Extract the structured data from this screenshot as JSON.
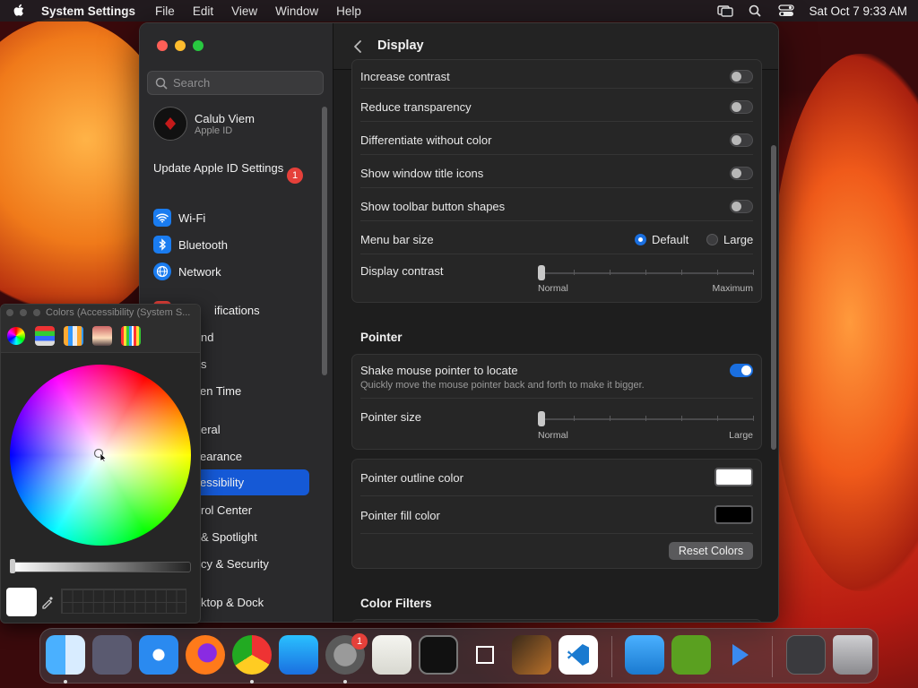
{
  "menubar": {
    "app_name": "System Settings",
    "items": [
      "File",
      "Edit",
      "View",
      "Window",
      "Help"
    ],
    "clock": "Sat Oct 7  9:33 AM"
  },
  "sidebar": {
    "search_placeholder": "Search",
    "profile_name": "Calub Viem",
    "profile_sub": "Apple ID",
    "update_label": "Update Apple ID Settings",
    "update_badge": "1",
    "items": [
      {
        "label": "Wi-Fi",
        "color": "#1a7cf0"
      },
      {
        "label": "Bluetooth",
        "color": "#1a7cf0"
      },
      {
        "label": "Network",
        "color": "#1a7cf0"
      },
      {
        "label": "Notifications",
        "color": "#e5403a"
      },
      {
        "label": "Sound",
        "color": "#e5403a"
      },
      {
        "label": "Focus",
        "color": "#5a4fd6"
      },
      {
        "label": "Screen Time",
        "color": "#5a4fd6"
      },
      {
        "label": "General",
        "color": "#8e8e93"
      },
      {
        "label": "Appearance",
        "color": "#1c1c1e"
      },
      {
        "label": "Accessibility",
        "color": "#1a7cf0"
      },
      {
        "label": "Control Center",
        "color": "#8e8e93"
      },
      {
        "label": "Siri & Spotlight",
        "color": "#b84ad6"
      },
      {
        "label": "Privacy & Security",
        "color": "#1a7cf0"
      },
      {
        "label": "Desktop & Dock",
        "color": "#1c1c1e"
      }
    ],
    "visible_labels": [
      "ifications",
      "nd",
      "s",
      "en Time",
      "eral",
      "earance",
      "essibility",
      "rol Center",
      "& Spotlight",
      "cy & Security",
      "ktop & Dock"
    ]
  },
  "content": {
    "title": "Display",
    "display_group": {
      "increase_contrast": "Increase contrast",
      "reduce_transparency": "Reduce transparency",
      "differentiate": "Differentiate without color",
      "window_title_icons": "Show window title icons",
      "toolbar_shapes": "Show toolbar button shapes",
      "menu_bar_size": "Menu bar size",
      "menu_bar_default": "Default",
      "menu_bar_large": "Large",
      "display_contrast": "Display contrast",
      "contrast_min": "Normal",
      "contrast_max": "Maximum",
      "contrast_value": 0
    },
    "pointer_title": "Pointer",
    "pointer_group": {
      "shake_label": "Shake mouse pointer to locate",
      "shake_sub": "Quickly move the mouse pointer back and forth to make it bigger.",
      "shake_on": true,
      "size_label": "Pointer size",
      "size_min": "Normal",
      "size_max": "Large",
      "size_value": 0
    },
    "colors_group": {
      "outline_label": "Pointer outline color",
      "outline_color": "#ffffff",
      "fill_label": "Pointer fill color",
      "fill_color": "#000000",
      "reset_label": "Reset Colors"
    },
    "color_filters_title": "Color Filters"
  },
  "colors_panel": {
    "title": "Colors (Accessibility (System S..."
  },
  "dock": {
    "settings_badge": "1"
  }
}
